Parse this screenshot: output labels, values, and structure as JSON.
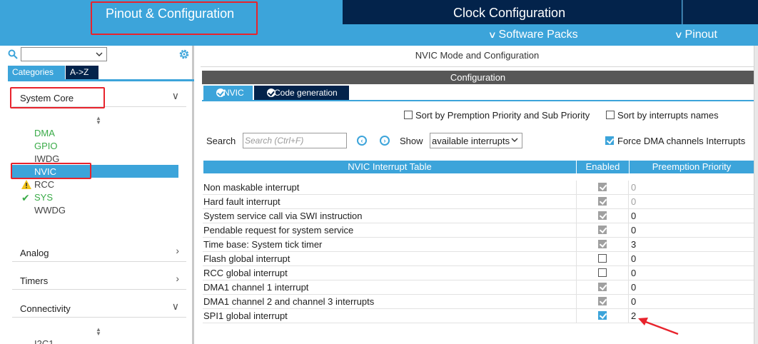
{
  "top_tabs": {
    "pinout_config": "Pinout & Configuration",
    "clock_config": "Clock Configuration",
    "software_packs": "Software Packs",
    "pinout": "Pinout"
  },
  "left_panel": {
    "category_tabs": [
      "Categories",
      "A->Z"
    ],
    "system_core": {
      "label": "System Core",
      "items": [
        {
          "label": "DMA",
          "status": "ok"
        },
        {
          "label": "GPIO",
          "status": "ok"
        },
        {
          "label": "IWDG",
          "status": "none"
        },
        {
          "label": "NVIC",
          "status": "selected"
        },
        {
          "label": "RCC",
          "status": "warning"
        },
        {
          "label": "SYS",
          "status": "check"
        },
        {
          "label": "WWDG",
          "status": "none"
        }
      ]
    },
    "groups": [
      "Analog",
      "Timers",
      "Connectivity"
    ],
    "connectivity_first_item": "I2C1"
  },
  "right_panel": {
    "mode_title": "NVIC Mode and Configuration",
    "config_bar": "Configuration",
    "config_tabs": [
      "NVIC",
      "Code generation"
    ],
    "options": {
      "sort_premption": "Sort by Premption Priority and Sub Priority",
      "sort_names": "Sort by interrupts names",
      "force_dma": "Force DMA channels Interrupts"
    },
    "search_label": "Search",
    "search_placeholder": "Search (Ctrl+F)",
    "show_label": "Show",
    "show_value": "available interrupts"
  },
  "table": {
    "headers": [
      "NVIC Interrupt Table",
      "Enabled",
      "Preemption Priority"
    ],
    "rows": [
      {
        "name": "Non maskable interrupt",
        "enabled": "locked",
        "priority": "0",
        "dim": true
      },
      {
        "name": "Hard fault interrupt",
        "enabled": "locked",
        "priority": "0",
        "dim": true
      },
      {
        "name": "System service call via SWI instruction",
        "enabled": "locked",
        "priority": "0",
        "dim": false
      },
      {
        "name": "Pendable request for system service",
        "enabled": "locked",
        "priority": "0",
        "dim": false
      },
      {
        "name": "Time base: System tick timer",
        "enabled": "locked",
        "priority": "3",
        "dim": false
      },
      {
        "name": "Flash global interrupt",
        "enabled": "off",
        "priority": "0",
        "dim": false
      },
      {
        "name": "RCC global interrupt",
        "enabled": "off",
        "priority": "0",
        "dim": false
      },
      {
        "name": "DMA1 channel 1 interrupt",
        "enabled": "locked",
        "priority": "0",
        "dim": false
      },
      {
        "name": "DMA1 channel 2 and channel 3 interrupts",
        "enabled": "locked",
        "priority": "0",
        "dim": false
      },
      {
        "name": "SPI1 global interrupt",
        "enabled": "on",
        "priority": "2",
        "dim": false
      }
    ]
  },
  "colors": {
    "accent_blue": "#3ca4da",
    "navy": "#03234b",
    "annotation_red": "#e8232c",
    "ok_green": "#3aab48"
  }
}
